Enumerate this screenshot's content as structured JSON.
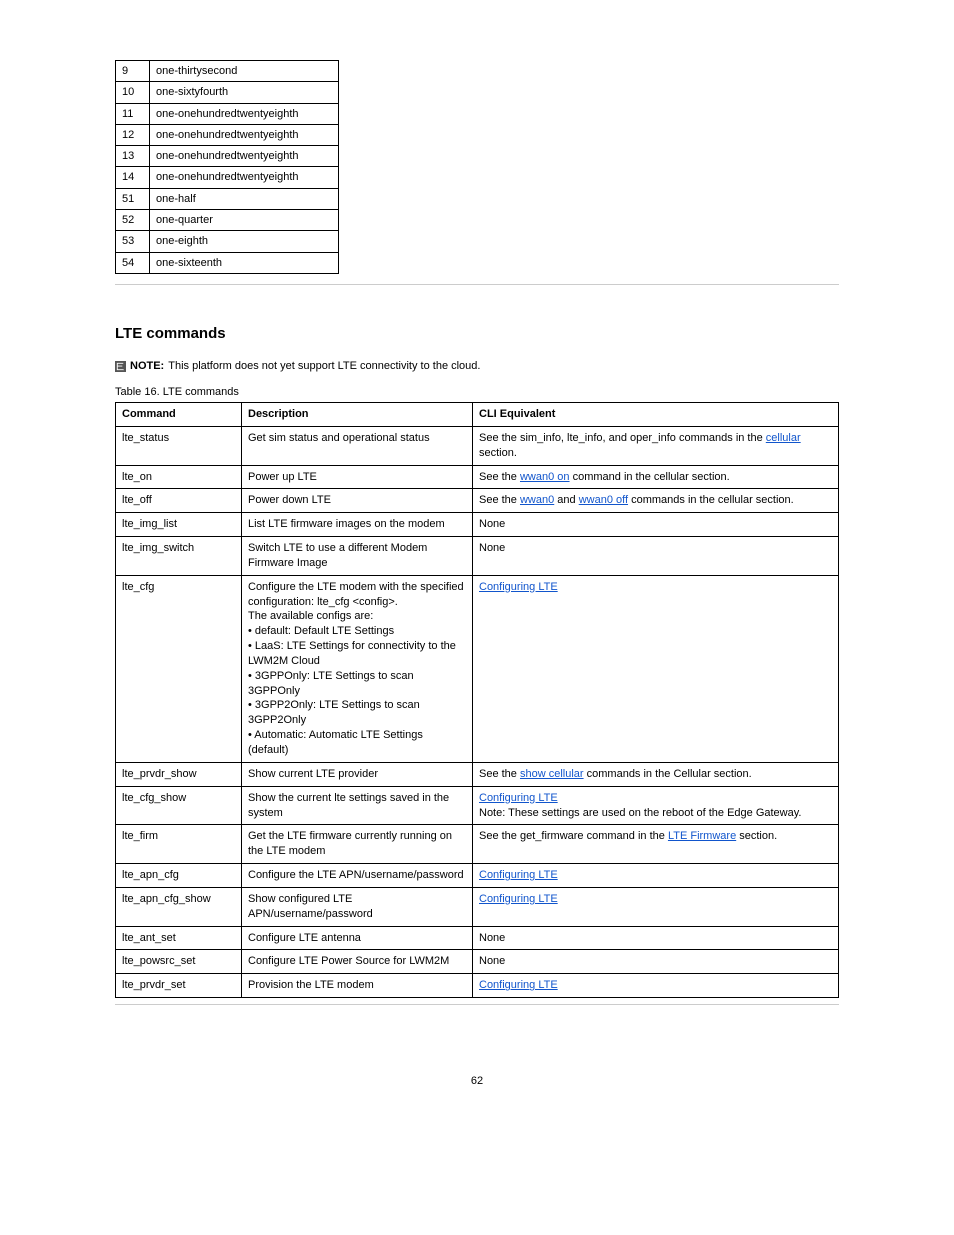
{
  "smallTable": [
    [
      "9",
      "one-thirtysecond"
    ],
    [
      "10",
      "one-sixtyfourth"
    ],
    [
      "11",
      "one-onehundredtwentyeighth"
    ],
    [
      "12",
      "one-onehundredtwentyeighth"
    ],
    [
      "13",
      "one-onehundredtwentyeighth"
    ],
    [
      "14",
      "one-onehundredtwentyeighth"
    ],
    [
      "51",
      "one-half"
    ],
    [
      "52",
      "one-quarter"
    ],
    [
      "53",
      "one-eighth"
    ],
    [
      "54",
      "one-sixteenth"
    ]
  ],
  "section": {
    "title": "LTE commands",
    "note_label": "NOTE: ",
    "note_text": " This platform does not yet support LTE connectivity to the cloud.",
    "table_caption": "Table 16. LTE commands"
  },
  "mainTable": {
    "headers": [
      "Command",
      "Description",
      "CLI Equivalent"
    ],
    "rows": [
      {
        "cmd": "lte_status",
        "desc": "Get sim status and operational status",
        "cli": [
          {
            "t": "See the sim_info, lte_info, and oper_info commands in the "
          },
          {
            "t": "cellular",
            "link": true
          },
          {
            "t": " section."
          }
        ]
      },
      {
        "cmd": "lte_on",
        "desc": "Power up LTE",
        "cli": [
          {
            "t": "See the "
          },
          {
            "t": "wwan0 on",
            "link": true
          },
          {
            "t": " command in the cellular section."
          }
        ]
      },
      {
        "cmd": "lte_off",
        "desc": "Power down LTE",
        "cli": [
          {
            "t": "See the "
          },
          {
            "t": "wwan0",
            "link": true
          },
          {
            "t": " and "
          },
          {
            "t": "wwan0 off",
            "link": true
          },
          {
            "t": " commands in the cellular section."
          }
        ]
      },
      {
        "cmd": "lte_img_list",
        "desc": "List LTE firmware images on the modem",
        "cli": [
          {
            "t": "None"
          }
        ]
      },
      {
        "cmd": "lte_img_switch",
        "desc": "Switch LTE to use a different Modem Firmware Image",
        "cli": [
          {
            "t": "None"
          }
        ]
      },
      {
        "cmd": "lte_cfg",
        "desc": "Configure the LTE modem with the specified configuration: lte_cfg <config>.\nThe available configs are:\n• default: Default LTE Settings\n• LaaS: LTE Settings for connectivity to the LWM2M Cloud\n• 3GPPOnly: LTE Settings to scan 3GPPOnly\n• 3GPP2Only: LTE Settings to scan 3GPP2Only\n• Automatic: Automatic LTE Settings (default)",
        "cli": [
          {
            "t": "Configuring LTE",
            "link": true
          }
        ]
      },
      {
        "cmd": "lte_prvdr_show",
        "desc": "Show current LTE provider",
        "cli": [
          {
            "t": "See the "
          },
          {
            "t": "show cellular",
            "link": true
          },
          {
            "t": " commands in the Cellular section."
          }
        ]
      },
      {
        "cmd": "lte_cfg_show",
        "desc": "Show the current lte settings saved in the system",
        "cli": [
          {
            "t": "Configuring LTE",
            "link": true
          },
          {
            "t": "\nNote: These settings are used on the reboot of the Edge Gateway."
          }
        ]
      },
      {
        "cmd": "lte_firm",
        "desc": "Get the LTE firmware currently running on the LTE modem",
        "cli": [
          {
            "t": "See the get_firmware command in the ",
            "pre": ""
          },
          {
            "t": "LTE Firmware",
            "link": true
          },
          {
            "t": " section."
          }
        ]
      },
      {
        "cmd": "lte_apn_cfg",
        "desc": "Configure the LTE APN/username/password",
        "cli": [
          {
            "t": "Configuring LTE",
            "link": true
          }
        ]
      },
      {
        "cmd": "lte_apn_cfg_show",
        "desc": "Show configured LTE APN/username/password",
        "cli": [
          {
            "t": "Configuring LTE",
            "link": true
          }
        ]
      },
      {
        "cmd": "lte_ant_set",
        "desc": "Configure LTE antenna",
        "cli": [
          {
            "t": "None"
          }
        ]
      },
      {
        "cmd": "lte_powsrc_set",
        "desc": "Configure LTE Power Source for LWM2M",
        "cli": [
          {
            "t": "None"
          }
        ]
      },
      {
        "cmd": "lte_prvdr_set",
        "desc": "Provision the LTE modem",
        "cli": [
          {
            "t": "Configuring LTE",
            "link": true
          }
        ]
      }
    ]
  },
  "pageNumber": "62"
}
